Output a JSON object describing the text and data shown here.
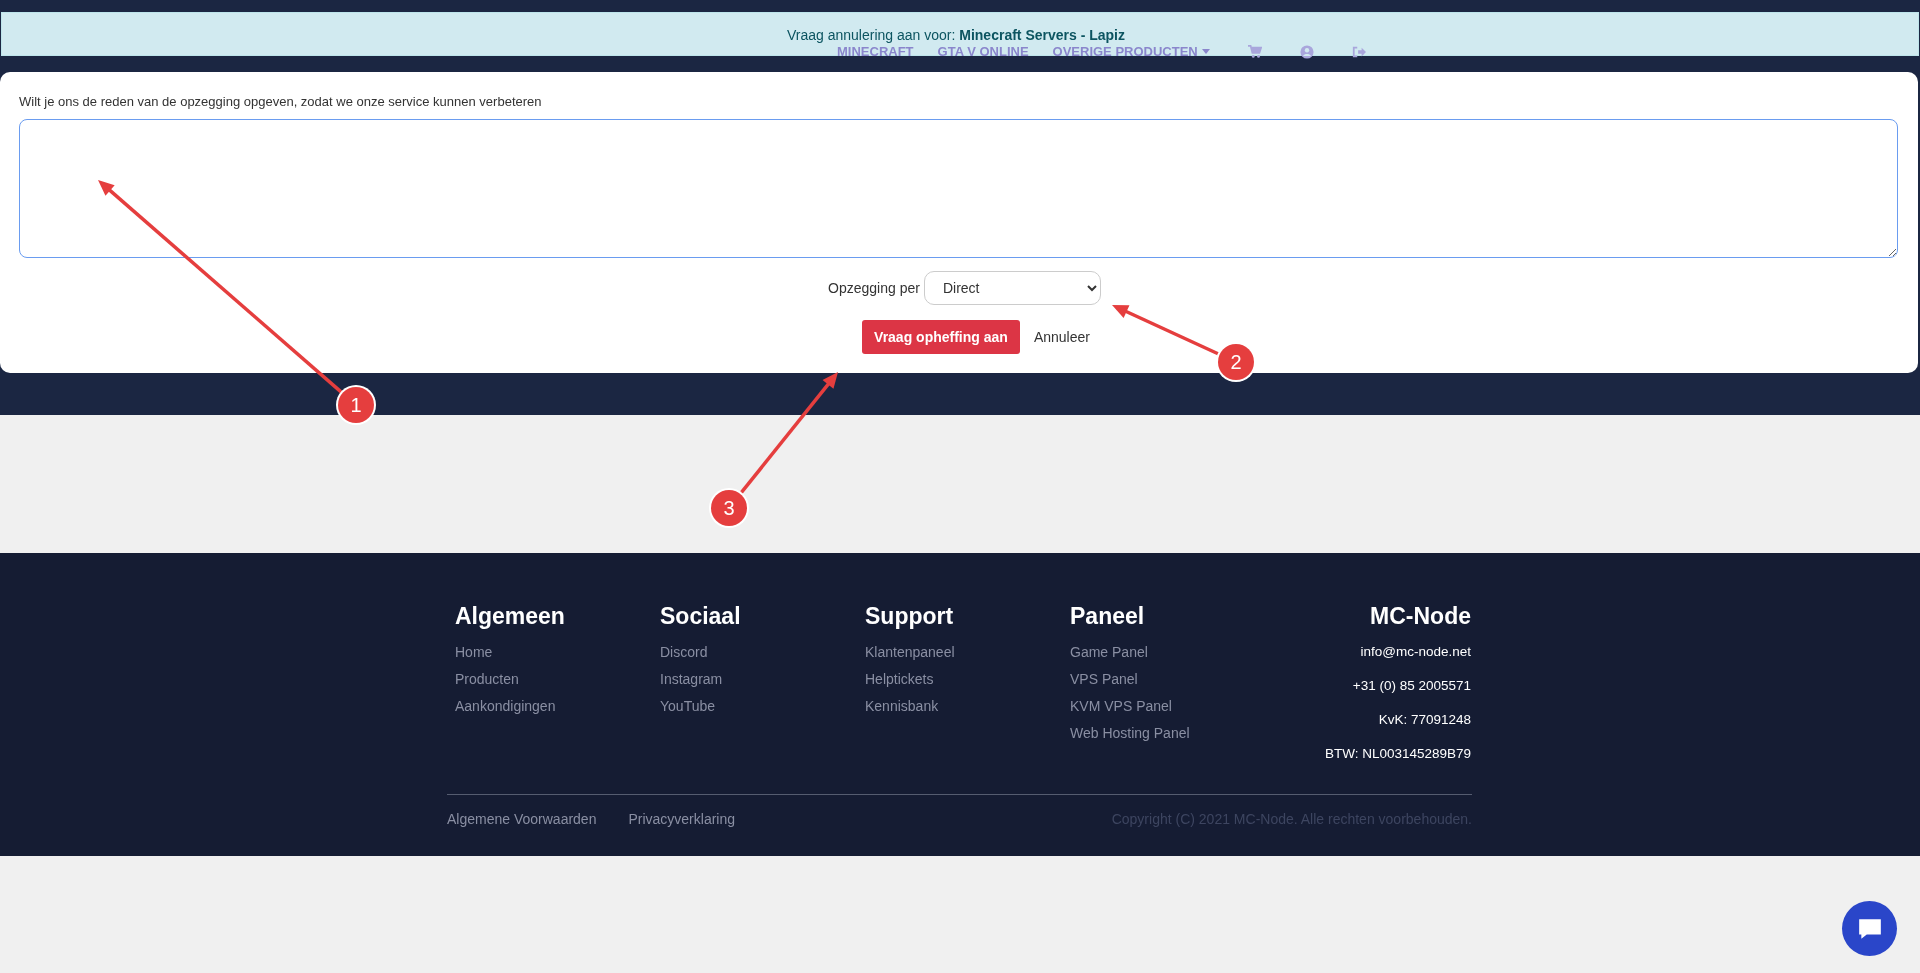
{
  "header": {
    "nav": [
      {
        "label": "MINECRAFT",
        "kind": "link"
      },
      {
        "label": "GTA V ONLINE",
        "kind": "link"
      },
      {
        "label": "OVERIGE PRODUCTEN",
        "kind": "dropdown"
      }
    ],
    "icons": [
      {
        "kind": "cart"
      },
      {
        "kind": "user"
      },
      {
        "kind": "logout"
      }
    ]
  },
  "banner": {
    "text": "Vraag annulering aan voor: ",
    "product": "Minecraft Servers - Lapiz"
  },
  "form": {
    "reason_label": "Wilt je ons de reden van de opzegging opgeven, zodat we onze service kunnen verbeteren",
    "period_label": "Opzegging per",
    "period_value": "Direct",
    "submit": "Vraag opheffing aan",
    "cancel": "Annuleer"
  },
  "footer": {
    "columns": [
      {
        "title": "Algemeen",
        "links": [
          "Home",
          "Producten",
          "Aankondigingen"
        ]
      },
      {
        "title": "Sociaal",
        "links": [
          "Discord",
          "Instagram",
          "YouTube"
        ]
      },
      {
        "title": "Support",
        "links": [
          "Klantenpaneel",
          "Helptickets",
          "Kennisbank"
        ]
      },
      {
        "title": "Paneel",
        "links": [
          "Game Panel",
          "VPS Panel",
          "KVM VPS Panel",
          "Web Hosting Panel"
        ]
      }
    ],
    "contact": {
      "title": "MC-Node",
      "lines": [
        "info@mc-node.net",
        "+31 (0) 85 2005571",
        "KvK: 77091248",
        "BTW: NL003145289B79"
      ]
    },
    "bottom_links": [
      "Algemene Voorwaarden",
      "Privacyverklaring"
    ],
    "copyright": "Copyright (C) 2021 MC-Node. Alle rechten voorbehouden."
  },
  "annotations": [
    "1",
    "2",
    "3"
  ]
}
